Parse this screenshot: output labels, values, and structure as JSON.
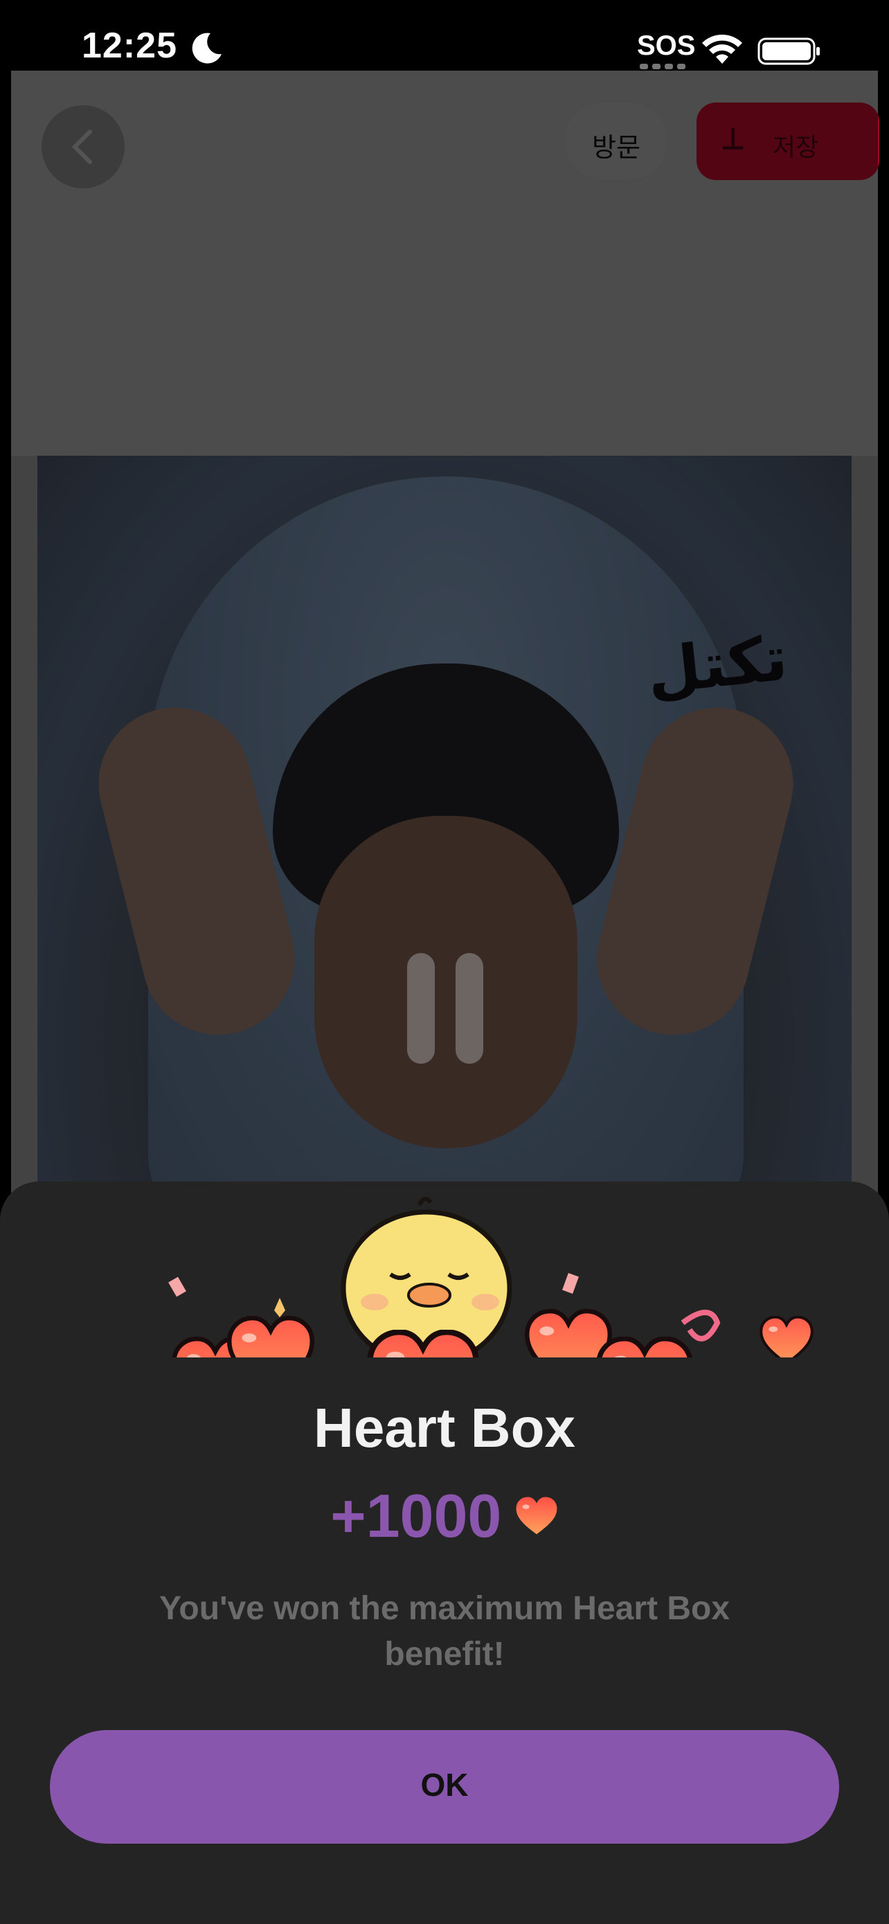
{
  "status_bar": {
    "time": "12:25",
    "sos": "SOS",
    "icons": [
      "moon-icon",
      "wifi-icon",
      "battery-icon"
    ]
  },
  "header": {
    "back_icon": "chevron-left-icon",
    "visit_label": "방문",
    "save_icon": "pin-icon",
    "save_label": "저장"
  },
  "media": {
    "hood_text": "تكتل",
    "overlay_icon": "pause-icon"
  },
  "popup": {
    "illustration": "chick-holding-heart-with-heart-pile-icon",
    "title": "Heart Box",
    "amount": "+1000",
    "amount_icon": "heart-icon",
    "message": "You've won the maximum Heart Box benefit!",
    "ok_label": "OK"
  },
  "colors": {
    "accent_purple": "#8956ad",
    "save_red": "#9a0a25",
    "sheet_bg": "#242424",
    "heart_red": "#ff5a4a"
  }
}
